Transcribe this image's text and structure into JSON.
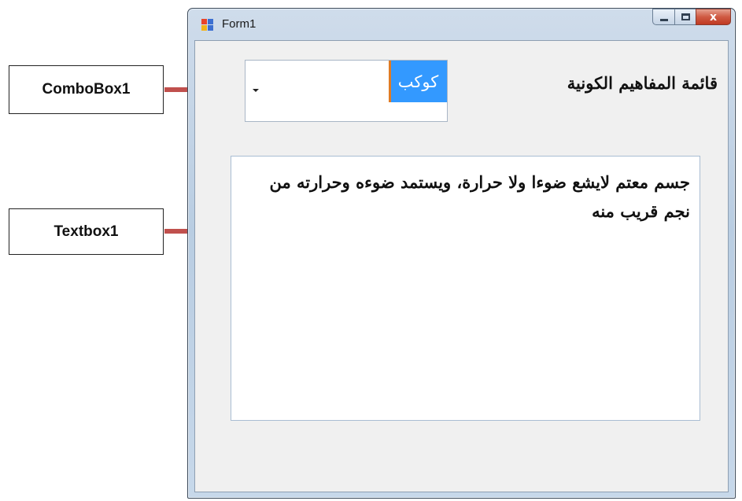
{
  "window": {
    "title": "Form1",
    "caption_buttons": {
      "minimize": "minimize",
      "maximize": "maximize",
      "close": "x"
    }
  },
  "form": {
    "label": "قائمة المفاهيم الكونية",
    "combobox": {
      "selected": "كوكب"
    },
    "textbox": {
      "value": "جسم معتم لايشع ضوءا ولا حرارة، ويستمد ضوءه وحرارته من نجم قريب منه"
    }
  },
  "annotations": {
    "combobox_callout": "ComboBox1",
    "textbox_callout": "Textbox1",
    "arrow_color": "#c0504d"
  }
}
